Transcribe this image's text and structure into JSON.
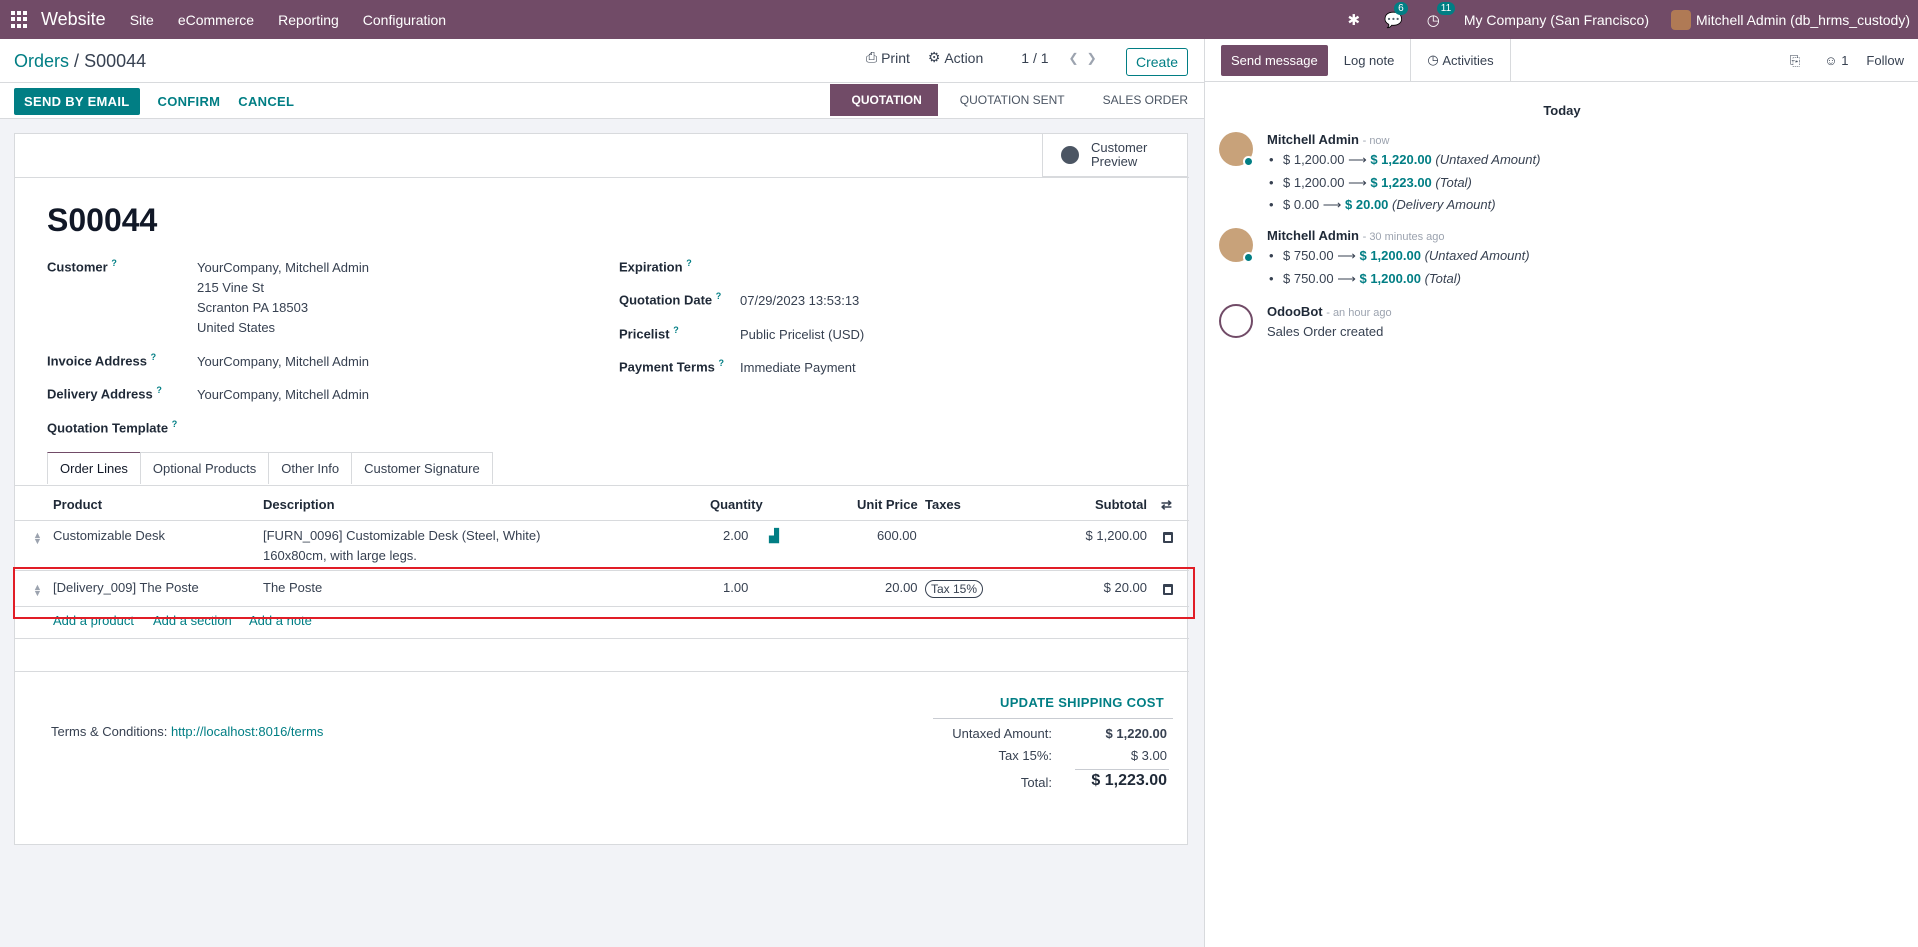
{
  "topbar": {
    "brand": "Website",
    "menu": [
      "Site",
      "eCommerce",
      "Reporting",
      "Configuration"
    ],
    "messages_count": "6",
    "activities_count": "11",
    "company": "My Company (San Francisco)",
    "user": "Mitchell Admin (db_hrms_custody)"
  },
  "control": {
    "breadcrumb_parent": "Orders",
    "breadcrumb_sep": "/",
    "breadcrumb_current": "S00044",
    "print": "Print",
    "action": "Action",
    "pager": "1 / 1",
    "create": "Create"
  },
  "statusbar": {
    "send_email": "SEND BY EMAIL",
    "confirm": "CONFIRM",
    "cancel": "CANCEL",
    "stages": [
      "QUOTATION",
      "QUOTATION SENT",
      "SALES ORDER"
    ],
    "active_stage": "QUOTATION"
  },
  "form": {
    "preview_line1": "Customer",
    "preview_line2": "Preview",
    "name": "S00044",
    "customer_label": "Customer",
    "customer_lines": [
      "YourCompany, Mitchell Admin",
      "215 Vine St",
      "Scranton PA 18503",
      "United States"
    ],
    "invoice_label": "Invoice Address",
    "invoice_value": "YourCompany, Mitchell Admin",
    "delivery_label": "Delivery Address",
    "delivery_value": "YourCompany, Mitchell Admin",
    "template_label": "Quotation Template",
    "expiration_label": "Expiration",
    "qdate_label": "Quotation Date",
    "qdate_value": "07/29/2023 13:53:13",
    "pricelist_label": "Pricelist",
    "pricelist_value": "Public Pricelist (USD)",
    "terms_label": "Payment Terms",
    "terms_value": "Immediate Payment",
    "help_mark": "?"
  },
  "tabs": [
    "Order Lines",
    "Optional Products",
    "Other Info",
    "Customer Signature"
  ],
  "table": {
    "headers": {
      "product": "Product",
      "description": "Description",
      "quantity": "Quantity",
      "unit_price": "Unit Price",
      "taxes": "Taxes",
      "subtotal": "Subtotal"
    },
    "rows": [
      {
        "product": "Customizable Desk",
        "description1": "[FURN_0096] Customizable Desk (Steel, White)",
        "description2": "160x80cm, with large legs.",
        "quantity": "2.00",
        "unit_price": "600.00",
        "tax": "",
        "subtotal": "$ 1,200.00"
      },
      {
        "product": "[Delivery_009] The Poste",
        "description1": "The Poste",
        "description2": "",
        "quantity": "1.00",
        "unit_price": "20.00",
        "tax": "Tax 15%",
        "subtotal": "$ 20.00"
      }
    ],
    "add_product": "Add a product",
    "add_section": "Add a section",
    "add_note": "Add a note"
  },
  "footer": {
    "terms_prefix": "Terms & Conditions:",
    "terms_link": "http://localhost:8016/terms",
    "update_shipping": "UPDATE SHIPPING COST",
    "untaxed_label": "Untaxed Amount:",
    "untaxed_value": "$ 1,220.00",
    "tax_label": "Tax 15%:",
    "tax_value": "$ 3.00",
    "total_label": "Total:",
    "total_value": "$ 1,223.00"
  },
  "chatter": {
    "send_message": "Send message",
    "log_note": "Log note",
    "activities": "Activities",
    "followers": "1",
    "follow": "Follow",
    "today": "Today",
    "messages": [
      {
        "author": "Mitchell Admin",
        "time": "- now",
        "tracking": [
          {
            "old": "$ 1,200.00",
            "new": "$ 1,220.00",
            "field": "(Untaxed Amount)"
          },
          {
            "old": "$ 1,200.00",
            "new": "$ 1,223.00",
            "field": "(Total)"
          },
          {
            "old": "$ 0.00",
            "new": "$ 20.00",
            "field": "(Delivery Amount)"
          }
        ]
      },
      {
        "author": "Mitchell Admin",
        "time": "- 30 minutes ago",
        "tracking": [
          {
            "old": "$ 750.00",
            "new": "$ 1,200.00",
            "field": "(Untaxed Amount)"
          },
          {
            "old": "$ 750.00",
            "new": "$ 1,200.00",
            "field": "(Total)"
          }
        ]
      },
      {
        "author": "OdooBot",
        "time": "- an hour ago",
        "body": "Sales Order created"
      }
    ]
  },
  "colors": {
    "brand": "#714b67",
    "accent": "#017e84",
    "highlight": "#e11d26"
  }
}
